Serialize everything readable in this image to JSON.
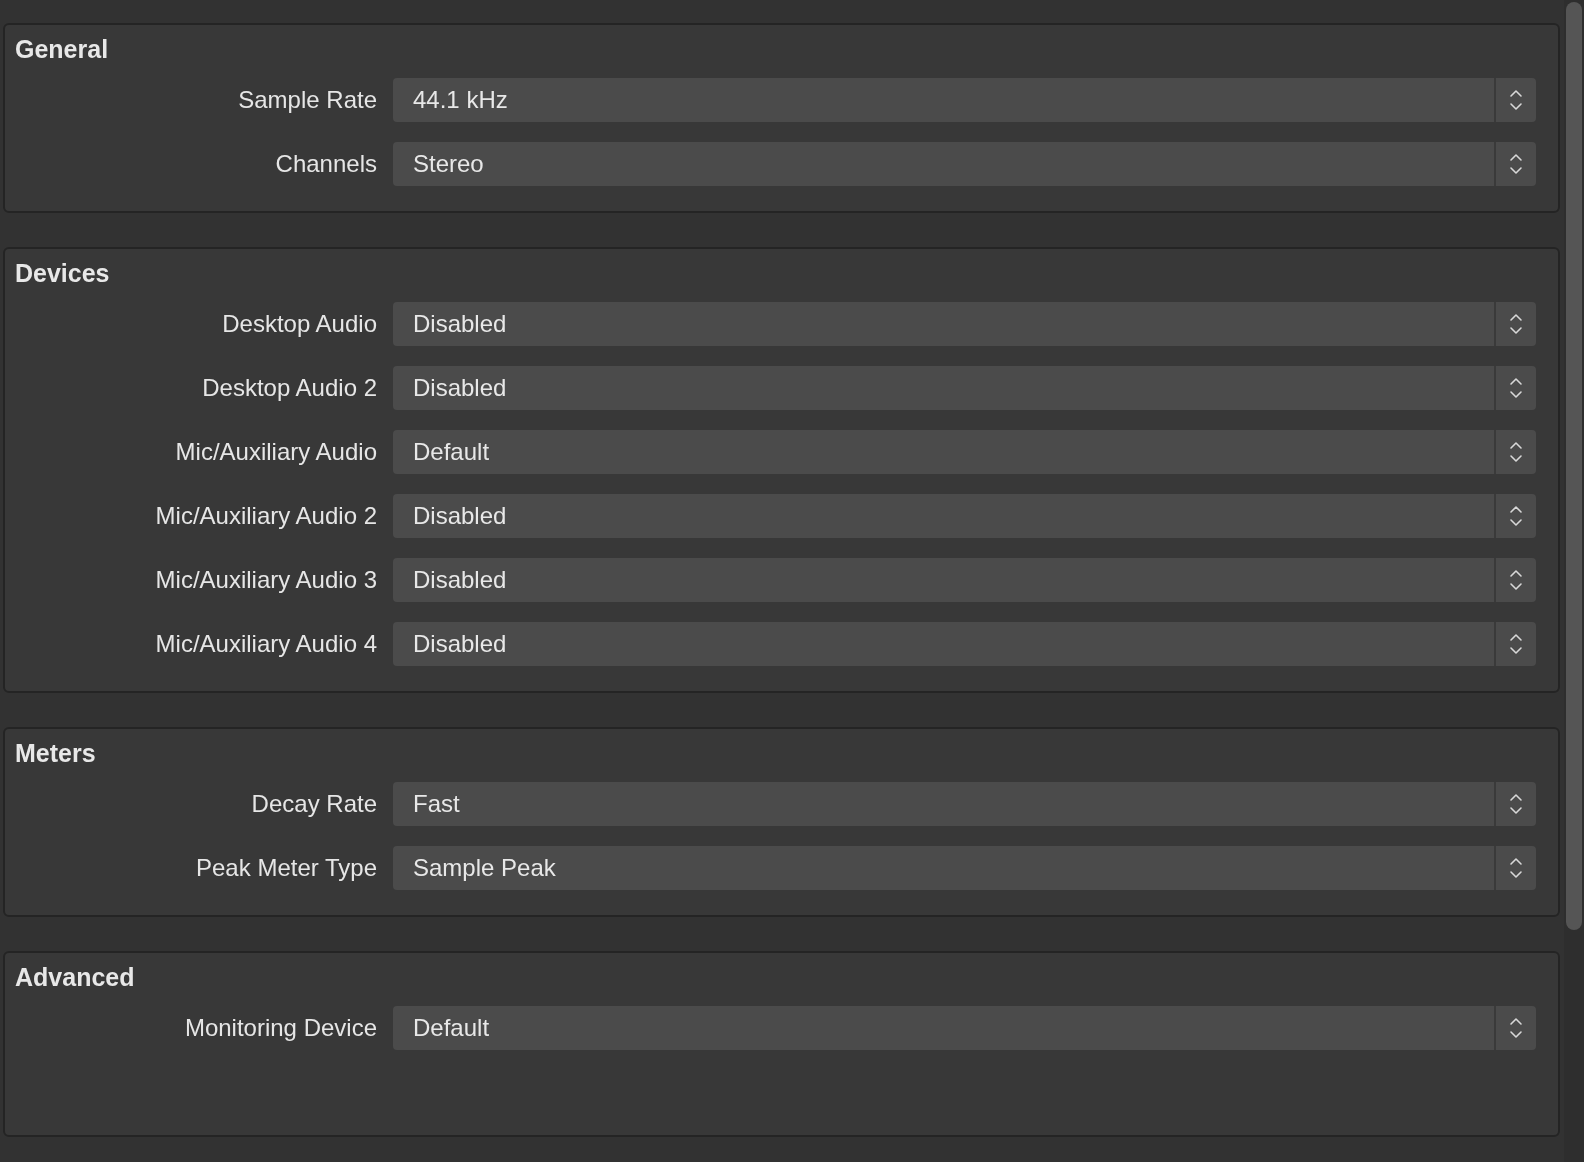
{
  "groups": [
    {
      "title": "General",
      "rows": [
        {
          "label": "Sample Rate",
          "value": "44.1 kHz"
        },
        {
          "label": "Channels",
          "value": "Stereo"
        }
      ]
    },
    {
      "title": "Devices",
      "rows": [
        {
          "label": "Desktop Audio",
          "value": "Disabled"
        },
        {
          "label": "Desktop Audio 2",
          "value": "Disabled"
        },
        {
          "label": "Mic/Auxiliary Audio",
          "value": "Default"
        },
        {
          "label": "Mic/Auxiliary Audio 2",
          "value": "Disabled"
        },
        {
          "label": "Mic/Auxiliary Audio 3",
          "value": "Disabled"
        },
        {
          "label": "Mic/Auxiliary Audio 4",
          "value": "Disabled"
        }
      ]
    },
    {
      "title": "Meters",
      "rows": [
        {
          "label": "Decay Rate",
          "value": "Fast"
        },
        {
          "label": "Peak Meter Type",
          "value": "Sample Peak"
        }
      ]
    },
    {
      "title": "Advanced",
      "rows": [
        {
          "label": "Monitoring Device",
          "value": "Default"
        }
      ]
    }
  ]
}
